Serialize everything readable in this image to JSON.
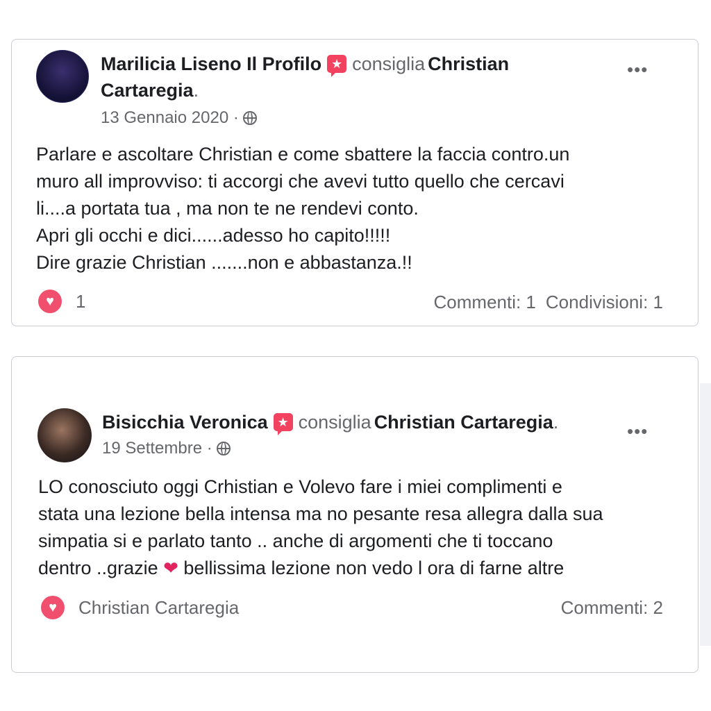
{
  "posts": [
    {
      "author": "Marilicia Liseno Il Profilo",
      "verb": "consiglia",
      "target": "Christian Cartaregia",
      "date": "13 Gennaio 2020",
      "separator": "·",
      "body": "Parlare e ascoltare Christian e come  sbattere la faccia contro.un\nmuro  all improvviso: ti accorgi che avevi tutto  quello che cercavi\nli....a portata tua , ma non te ne rendevi conto.\nApri gli occhi e dici......adesso ho capito!!!!!\nDire grazie Christian .......non e abbastanza.!!",
      "reactions": "1",
      "comments": "Commenti: 1",
      "shares": "Condivisioni: 1"
    },
    {
      "author": "Bisicchia Veronica",
      "verb": "consiglia",
      "target": "Christian Cartaregia",
      "date": "19 Settembre",
      "separator": "·",
      "body_before_heart": "LO conosciuto oggi Crhistian e Volevo fare i miei complimenti  e\nstata una lezione bella intensa ma no pesante resa allegra dalla sua\nsimpatia si e parlato tanto .. anche di argomenti che ti toccano\ndentro ..grazie ",
      "body_after_heart": "  bellissima lezione non vedo l ora di farne altre",
      "reactions": "Christian Cartaregia",
      "comments": "Commenti: 2"
    }
  ],
  "icons": {
    "recommend_badge": "★",
    "more": "•••",
    "love": "♥",
    "inline_heart": "❤"
  },
  "colors": {
    "recommend_badge": "#f3425f",
    "love": "#f0506e",
    "secondary_text": "#65676b"
  }
}
